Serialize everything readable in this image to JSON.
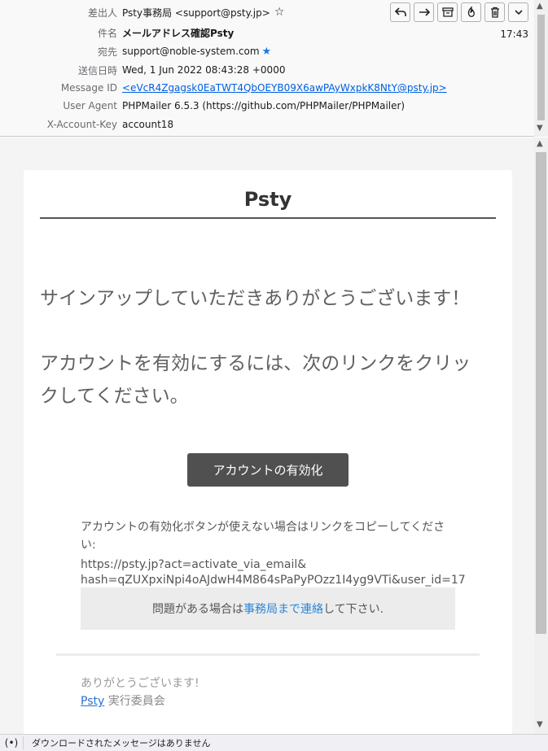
{
  "header": {
    "rows": [
      {
        "label": "差出人",
        "value": "Psty事務局 <support@psty.jp>"
      },
      {
        "label": "件名",
        "value": "メールアドレス確認Psty"
      },
      {
        "label": "宛先",
        "value": "support@noble-system.com"
      },
      {
        "label": "送信日時",
        "value": "Wed, 1 Jun 2022 08:43:28 +0000"
      },
      {
        "label": "Message ID",
        "value": "<eVcR4Zgagsk0EaTWT4QbOEYB09X6awPAyWxpkK8NtY@psty.jp>"
      },
      {
        "label": "User Agent",
        "value": "PHPMailer 6.5.3 (https://github.com/PHPMailer/PHPMailer)"
      },
      {
        "label": "X-Account-Key",
        "value": "account18"
      }
    ],
    "time": "17:43",
    "star_outline": "☆",
    "star_filled": "★"
  },
  "toolbar": {
    "icons": [
      "reply-icon",
      "forward-icon",
      "archive-icon",
      "junk-icon",
      "delete-icon",
      "more-icon"
    ]
  },
  "email": {
    "brand": "Psty",
    "line1": "サインアップしていただきありがとうございます！",
    "line2a": "アカウントを有効にするには、次のリンクをクリッ",
    "line2b": "クしてください。",
    "button": "アカウントの有効化",
    "fallback": "アカウントの有効化ボタンが使えない場合はリンクをコピーしてください:",
    "link1": "https://psty.jp?act=activate_via_email&",
    "link2": "hash=qZUXpxiNpi4oAJdwH4M864sPaPyPOzz1I4yg9VTi&user_id=17",
    "help_prefix": "問題がある場合は ",
    "help_link": "事務局まで連絡",
    "help_suffix": "して下さい.",
    "thanks": "ありがとうございます!",
    "sign_link": "Psty",
    "sign_suffix": " 実行委員会"
  },
  "status": {
    "text": "ダウンロードされたメッセージはありません",
    "icon": "(•)"
  },
  "colors": {
    "accent": "#0060df",
    "button_bg": "#505050",
    "star": "#1b78e3"
  }
}
